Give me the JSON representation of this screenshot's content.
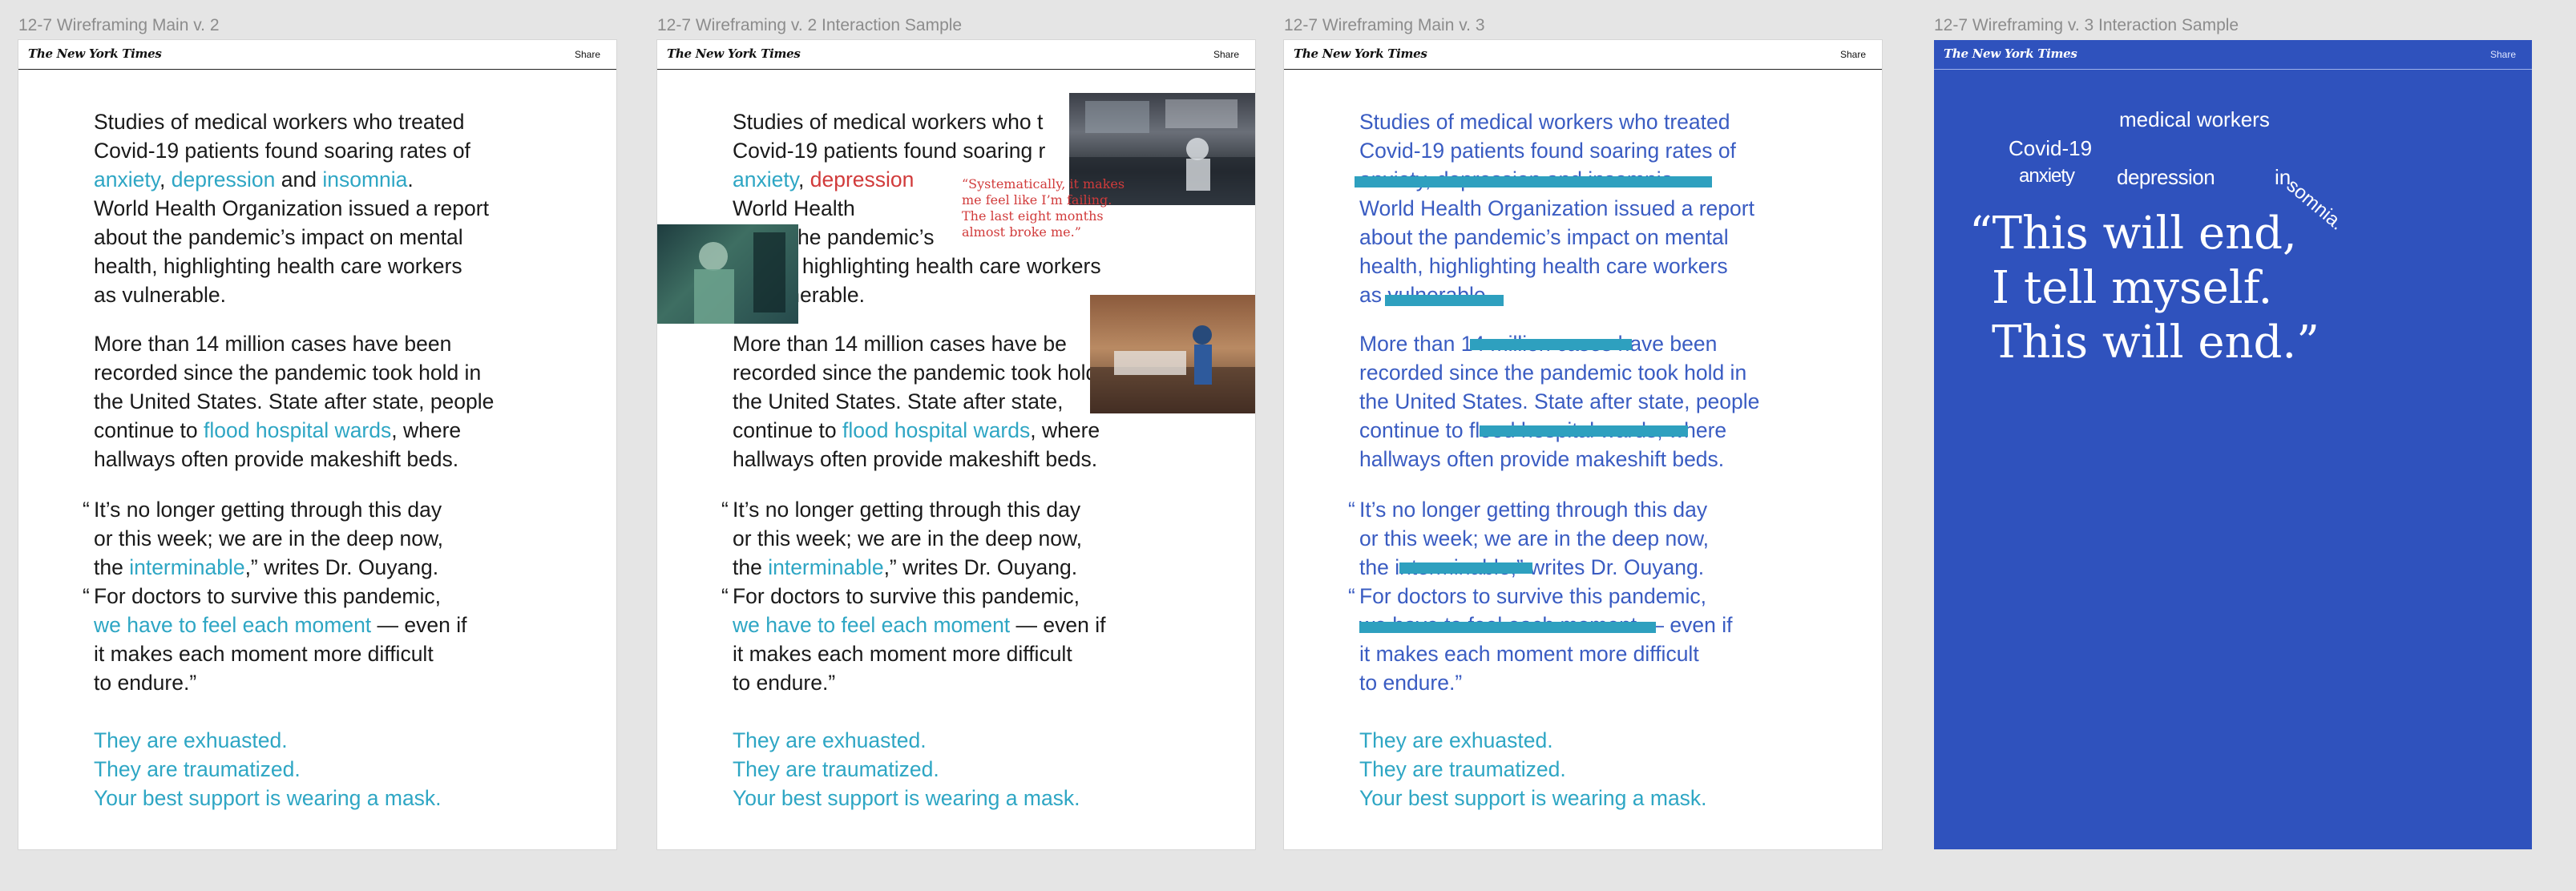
{
  "frames": [
    {
      "label": "12-7 Wireframing Main v. 2"
    },
    {
      "label": "12-7 Wireframing v. 2 Interaction Sample"
    },
    {
      "label": "12-7 Wireframing Main v. 3"
    },
    {
      "label": "12-7 Wireframing v. 3 Interaction Sample"
    }
  ],
  "header": {
    "logo": "The New York Times",
    "share": "Share"
  },
  "article": {
    "p1": {
      "l1": "Studies of medical workers who treated",
      "l2": "Covid-19 patients found soaring rates of",
      "w_anxiety": "anxiety",
      "comma": ", ",
      "w_depression": "depression",
      "and": " and ",
      "w_insomnia": "insomnia",
      "period": ".",
      "l4": "World Health Organization issued a report",
      "l5": "about the pandemic’s impact on mental",
      "l6": "health, highlighting health care workers",
      "l7": "as vulnerable."
    },
    "p2": {
      "l1": "More than 14 million cases have been",
      "l2": "recorded since the pandemic took hold in",
      "l3": "the United States. State after state, people",
      "l4a": "continue to ",
      "w_flood": "flood hospital wards",
      "l4b": ", where",
      "l5": "hallways often provide makeshift beds."
    },
    "q1": {
      "open": "“",
      "l1": "It’s no longer getting through this day",
      "l2": "or this week; we are in the deep now,",
      "l3a": "the ",
      "w_interminable": "interminable",
      "l3b": ",” writes Dr. Ouyang."
    },
    "q2": {
      "open": "“",
      "l1": "For doctors to survive this pandemic,",
      "w_feel": "we have to feel each moment",
      "l2b": " — even if",
      "l3": "it makes each moment more difficult",
      "l4": "to endure.”"
    },
    "closing": {
      "l1": "They are exhuasted.",
      "l2": "They are traumatized.",
      "l3": "Your best support is wearing a mask."
    }
  },
  "v2_sample": {
    "p1_l4": "World Health",
    "p1_l5": "about the pandemic’s",
    "p2_l1": "More than 14 million cases have be",
    "p2_l3": "the United States. State after state,",
    "l1_short": "Studies of medical workers who t",
    "l2_short": "Covid-19 patients found soaring r",
    "red_quote": {
      "l1": "“Systematically, it makes",
      "l2": "me feel like I’m failing.",
      "l3": "The last eight months",
      "l4": "almost broke me.”"
    }
  },
  "v3_main": {
    "p1_l3": "anxiety, depression and insomnia",
    "p2_l1a": "More than ",
    "p2_l1_struck": "14 million cases",
    "p2_l1b": " have been",
    "q1_l3_struck": "interminable",
    "q2_l2_struck": "we have to feel each moment"
  },
  "v3_sample": {
    "words": {
      "medical": "medical workers",
      "covid": "Covid-19",
      "anxiety": "anxiety",
      "depression": "depression",
      "in": "in",
      "somnia": "somnia."
    },
    "quote": {
      "l1": "“This will end,",
      "l2": "I tell myself.",
      "l3": "This will end.”"
    }
  },
  "colors": {
    "teal": "#2ea6c4",
    "red": "#d13b3b",
    "blue_panel": "#2f52bd",
    "blue_text": "#3a5cc2",
    "highlight": "#2ea0bf"
  }
}
